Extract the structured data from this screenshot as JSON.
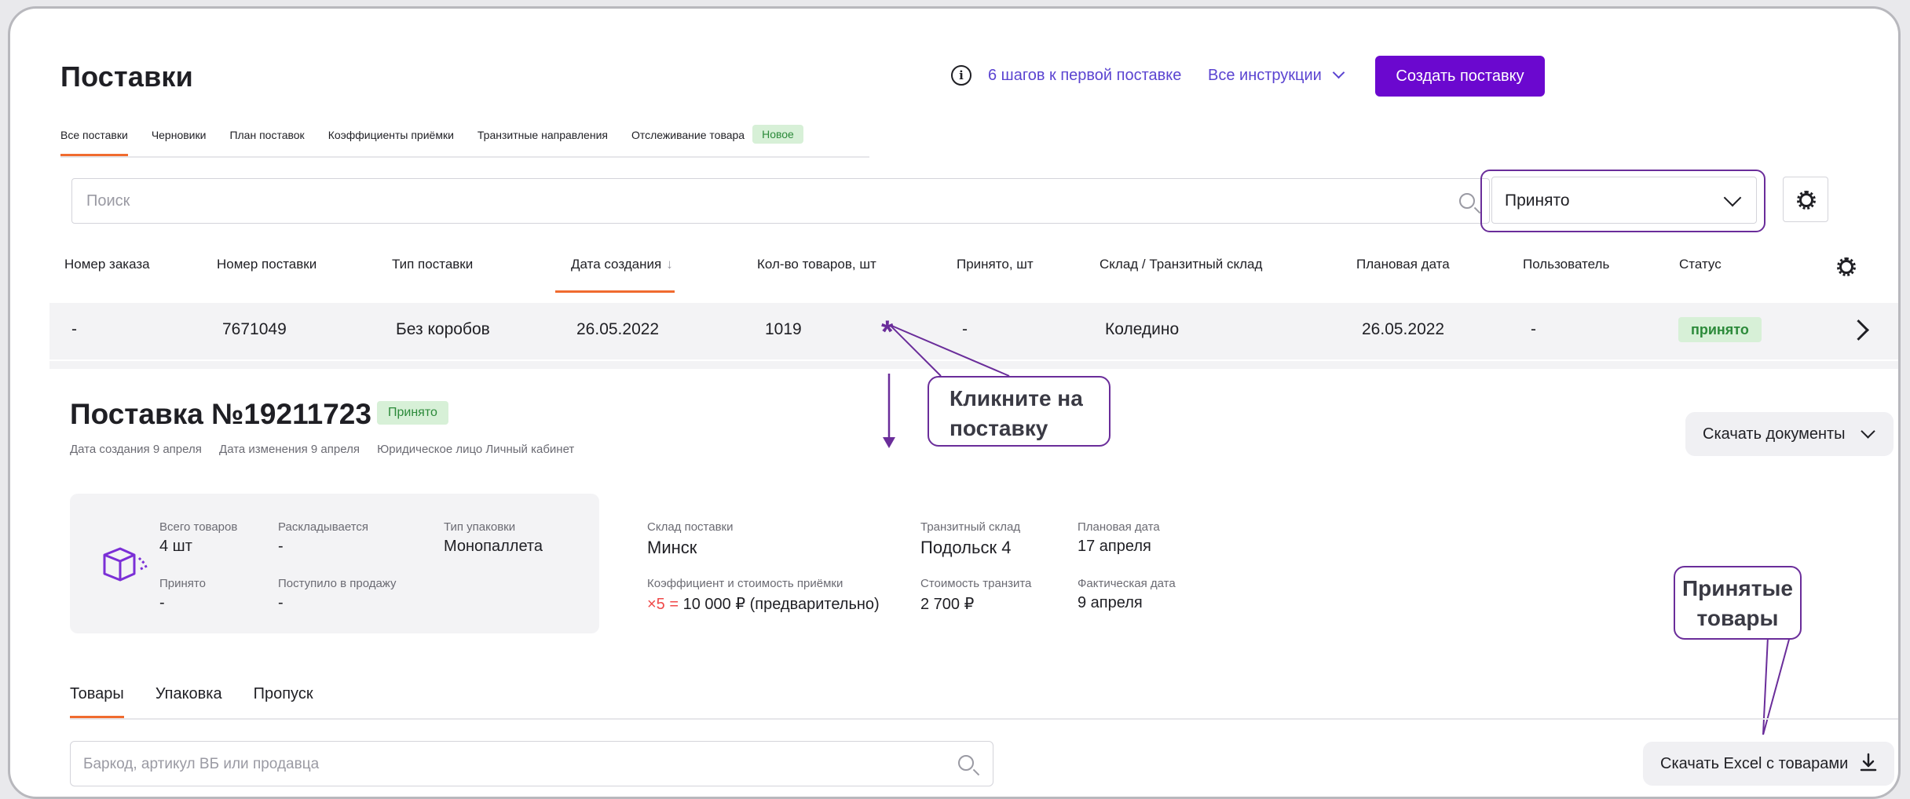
{
  "header": {
    "title": "Поставки",
    "steps_link": "6 шагов к первой поставке",
    "all_instructions": "Все инструкции",
    "create_button": "Создать поставку"
  },
  "tabs": [
    {
      "label": "Все поставки",
      "active": true
    },
    {
      "label": "Черновики"
    },
    {
      "label": "План поставок"
    },
    {
      "label": "Коэффициенты приёмки"
    },
    {
      "label": "Транзитные направления"
    },
    {
      "label": "Отслеживание товара"
    }
  ],
  "new_badge": "Новое",
  "search": {
    "placeholder": "Поиск"
  },
  "status_filter": {
    "value": "Принято"
  },
  "table": {
    "headers": [
      "Номер заказа",
      "Номер поставки",
      "Тип поставки",
      "Дата создания",
      "Кол-во товаров, шт",
      "Принято, шт",
      "Склад / Транзитный склад",
      "Плановая дата",
      "Пользователь",
      "Статус"
    ],
    "sort_indicator": "↓",
    "row": {
      "order": "-",
      "supply": "7671049",
      "type": "Без коробов",
      "created": "26.05.2022",
      "qty": "1019",
      "accepted": "-",
      "warehouse": "Коледино",
      "planned": "26.05.2022",
      "user": "-",
      "status": "принято"
    }
  },
  "annotations": {
    "click_supply": [
      "Кликните на",
      "поставку"
    ],
    "accepted_goods": [
      "Принятые",
      "товары"
    ],
    "marker": "*"
  },
  "detail": {
    "title": "Поставка №19211723",
    "badge": "Принято",
    "meta": [
      "Дата создания 9 апреля",
      "Дата изменения 9 апреля",
      "Юридическое лицо Личный кабинет"
    ],
    "download_docs": "Скачать документы",
    "card": {
      "total_label": "Всего товаров",
      "total_value": "4 шт",
      "laying_label": "Раскладывается",
      "laying_value": "-",
      "pack_label": "Тип упаковки",
      "pack_value": "Монопаллета",
      "accepted_label": "Принято",
      "accepted_value": "-",
      "sale_label": "Поступило в продажу",
      "sale_value": "-"
    },
    "warehouse_label": "Склад поставки",
    "warehouse_value": "Минск",
    "coef_label": "Коэффициент и стоимость приёмки",
    "coef_mult": "×5 =",
    "coef_value": "10 000 ₽ (предварительно)",
    "transit_label": "Транзитный склад",
    "transit_value": "Подольск 4",
    "transit_cost_label": "Стоимость транзита",
    "transit_cost_value": "2 700 ₽",
    "planned_label": "Плановая дата",
    "planned_value": "17 апреля",
    "actual_label": "Фактическая дата",
    "actual_value": "9 апреля"
  },
  "subtabs": [
    {
      "label": "Товары",
      "active": true
    },
    {
      "label": "Упаковка"
    },
    {
      "label": "Пропуск"
    }
  ],
  "goods_search": {
    "placeholder": "Баркод, артикул ВБ или продавца"
  },
  "excel_button": "Скачать Excel с товарами",
  "colors": {
    "primary": "#6b08cf",
    "accent_underline": "#f06b2f",
    "annotation": "#6a2d9a",
    "status_green": "#2c8a3a"
  }
}
